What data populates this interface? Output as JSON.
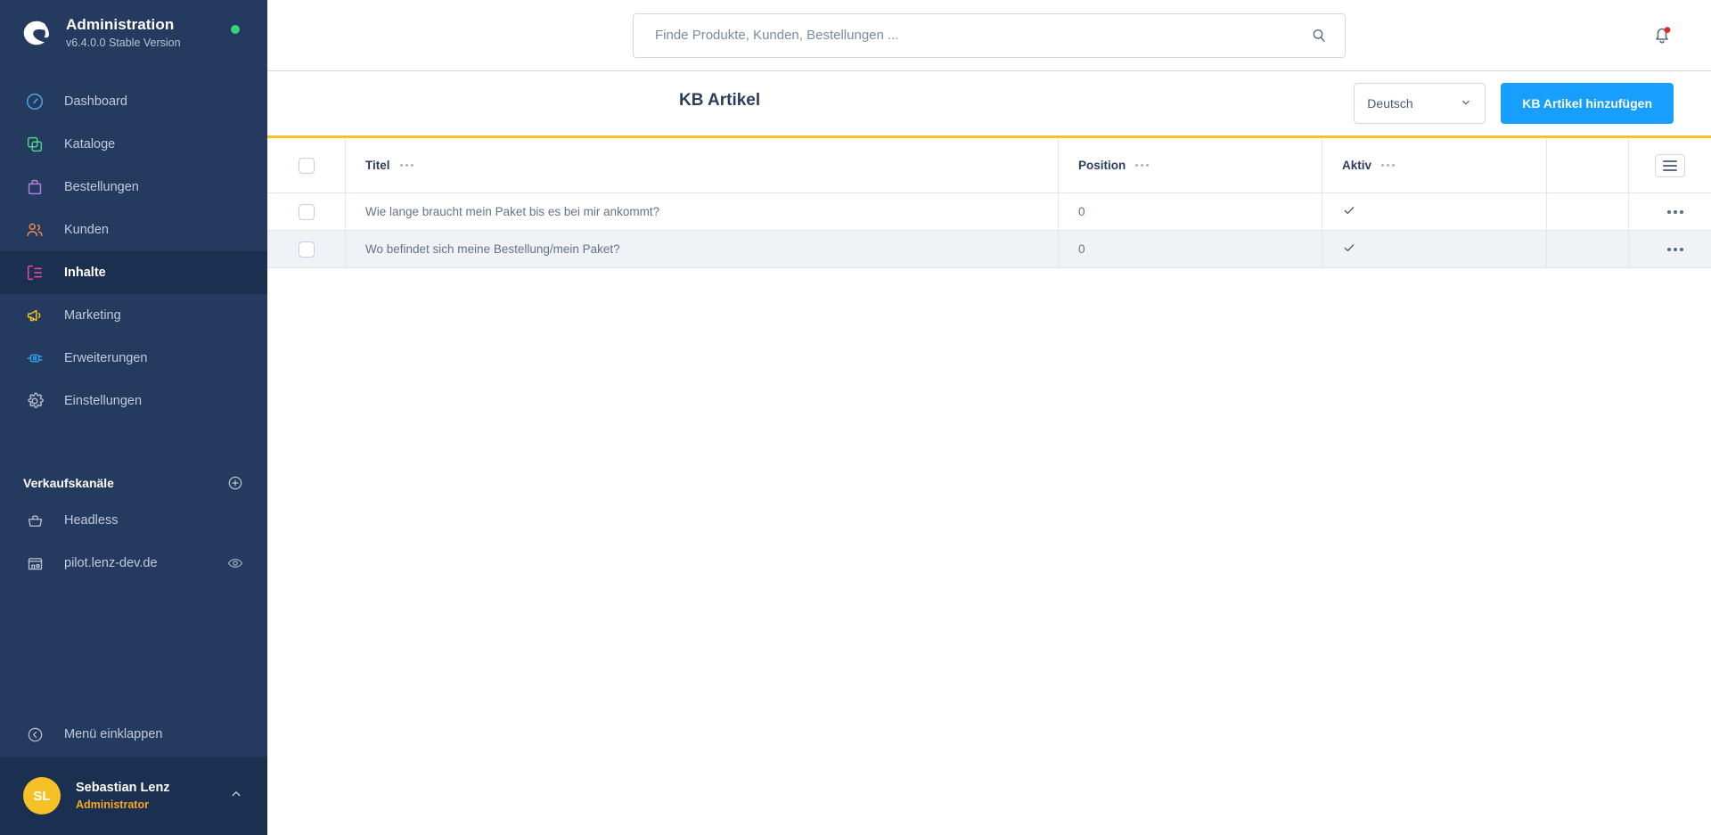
{
  "brand": {
    "title": "Administration",
    "version": "v6.4.0.0 Stable Version",
    "status_color": "#37d279",
    "logo_icon": "shopware-logo-icon"
  },
  "search": {
    "placeholder": "Finde Produkte, Kunden, Bestellungen ...",
    "value": "",
    "icon": "search-icon"
  },
  "notifications": {
    "icon": "bell-icon",
    "has_unread": true,
    "badge_color": "#e52427"
  },
  "sidebar": {
    "items": [
      {
        "label": "Dashboard",
        "icon": "speedometer-icon",
        "color": "#4fa8e8",
        "active": false
      },
      {
        "label": "Kataloge",
        "icon": "copy-icon",
        "color": "#4fd18b",
        "active": false
      },
      {
        "label": "Bestellungen",
        "icon": "bag-icon",
        "color": "#b07fe0",
        "active": false
      },
      {
        "label": "Kunden",
        "icon": "users-icon",
        "color": "#f08c4b",
        "active": false
      },
      {
        "label": "Inhalte",
        "icon": "content-icon",
        "color": "#ed4ba5",
        "active": true
      },
      {
        "label": "Marketing",
        "icon": "megaphone-icon",
        "color": "#f5c126",
        "active": false
      },
      {
        "label": "Erweiterungen",
        "icon": "plugin-icon",
        "color": "#2f9ee8",
        "active": false
      },
      {
        "label": "Einstellungen",
        "icon": "gear-icon",
        "color": "#b4bfcd",
        "active": false
      }
    ],
    "sales_channels": {
      "heading": "Verkaufskanäle",
      "add_icon": "plus-circle-icon",
      "items": [
        {
          "label": "Headless",
          "icon": "basket-icon",
          "has_eye": false
        },
        {
          "label": "pilot.lenz-dev.de",
          "icon": "storefront-icon",
          "has_eye": true,
          "eye_icon": "eye-icon"
        }
      ]
    },
    "collapse": {
      "label": "Menü einklappen",
      "icon": "chevron-left-circle-icon"
    },
    "user": {
      "initials": "SL",
      "name": "Sebastian Lenz",
      "role": "Administrator",
      "avatar_color": "#f5c126",
      "role_color": "#f5a623",
      "caret_icon": "chevron-up-icon"
    }
  },
  "page": {
    "title": "KB Artikel",
    "language": {
      "selected": "Deutsch",
      "caret_icon": "chevron-down-icon"
    },
    "add_button": {
      "label": "KB Artikel hinzufügen",
      "color": "#189eff"
    },
    "accent_rule_color": "#f5c126"
  },
  "table": {
    "select_all_checkbox": false,
    "settings_icon": "table-settings-icon",
    "column_menu_icon": "ellipsis-icon",
    "row_menu_icon": "ellipsis-icon",
    "active_icon": "check-icon",
    "columns": [
      {
        "key": "titel",
        "label": "Titel"
      },
      {
        "key": "position",
        "label": "Position"
      },
      {
        "key": "aktiv",
        "label": "Aktiv"
      }
    ],
    "rows": [
      {
        "checked": false,
        "titel": "Wie lange braucht mein Paket bis es bei mir ankommt?",
        "position": "0",
        "aktiv": true
      },
      {
        "checked": false,
        "titel": "Wo befindet sich meine Bestellung/mein Paket?",
        "position": "0",
        "aktiv": true
      }
    ]
  }
}
